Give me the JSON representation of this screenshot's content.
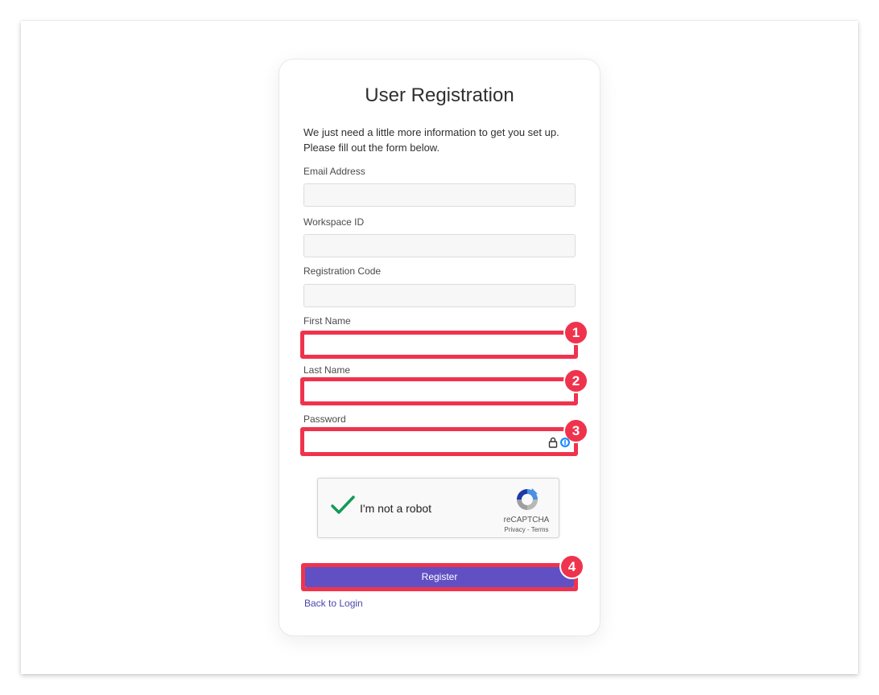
{
  "form": {
    "title": "User Registration",
    "intro_line1": "We just need a little more information to get you set up.",
    "intro_line2": "Please fill out the form below.",
    "fields": {
      "email_label": "Email Address",
      "workspace_label": "Workspace ID",
      "code_label": "Registration Code",
      "first_name_label": "First Name",
      "last_name_label": "Last Name",
      "password_label": "Password"
    },
    "captcha": {
      "label": "I'm not a robot",
      "brand": "reCAPTCHA",
      "links": "Privacy - Terms"
    },
    "register_label": "Register",
    "back_label": "Back to Login"
  },
  "annotations": {
    "badge_1": "1",
    "badge_2": "2",
    "badge_3": "3",
    "badge_4": "4"
  },
  "colors": {
    "highlight": "#f0334d",
    "primary_button": "#6150c4",
    "link": "#4a46b0",
    "captcha_check": "#109b57"
  },
  "icons": [
    "lock-icon",
    "password-manager-icon",
    "checkmark-icon",
    "recaptcha-logo-icon"
  ]
}
